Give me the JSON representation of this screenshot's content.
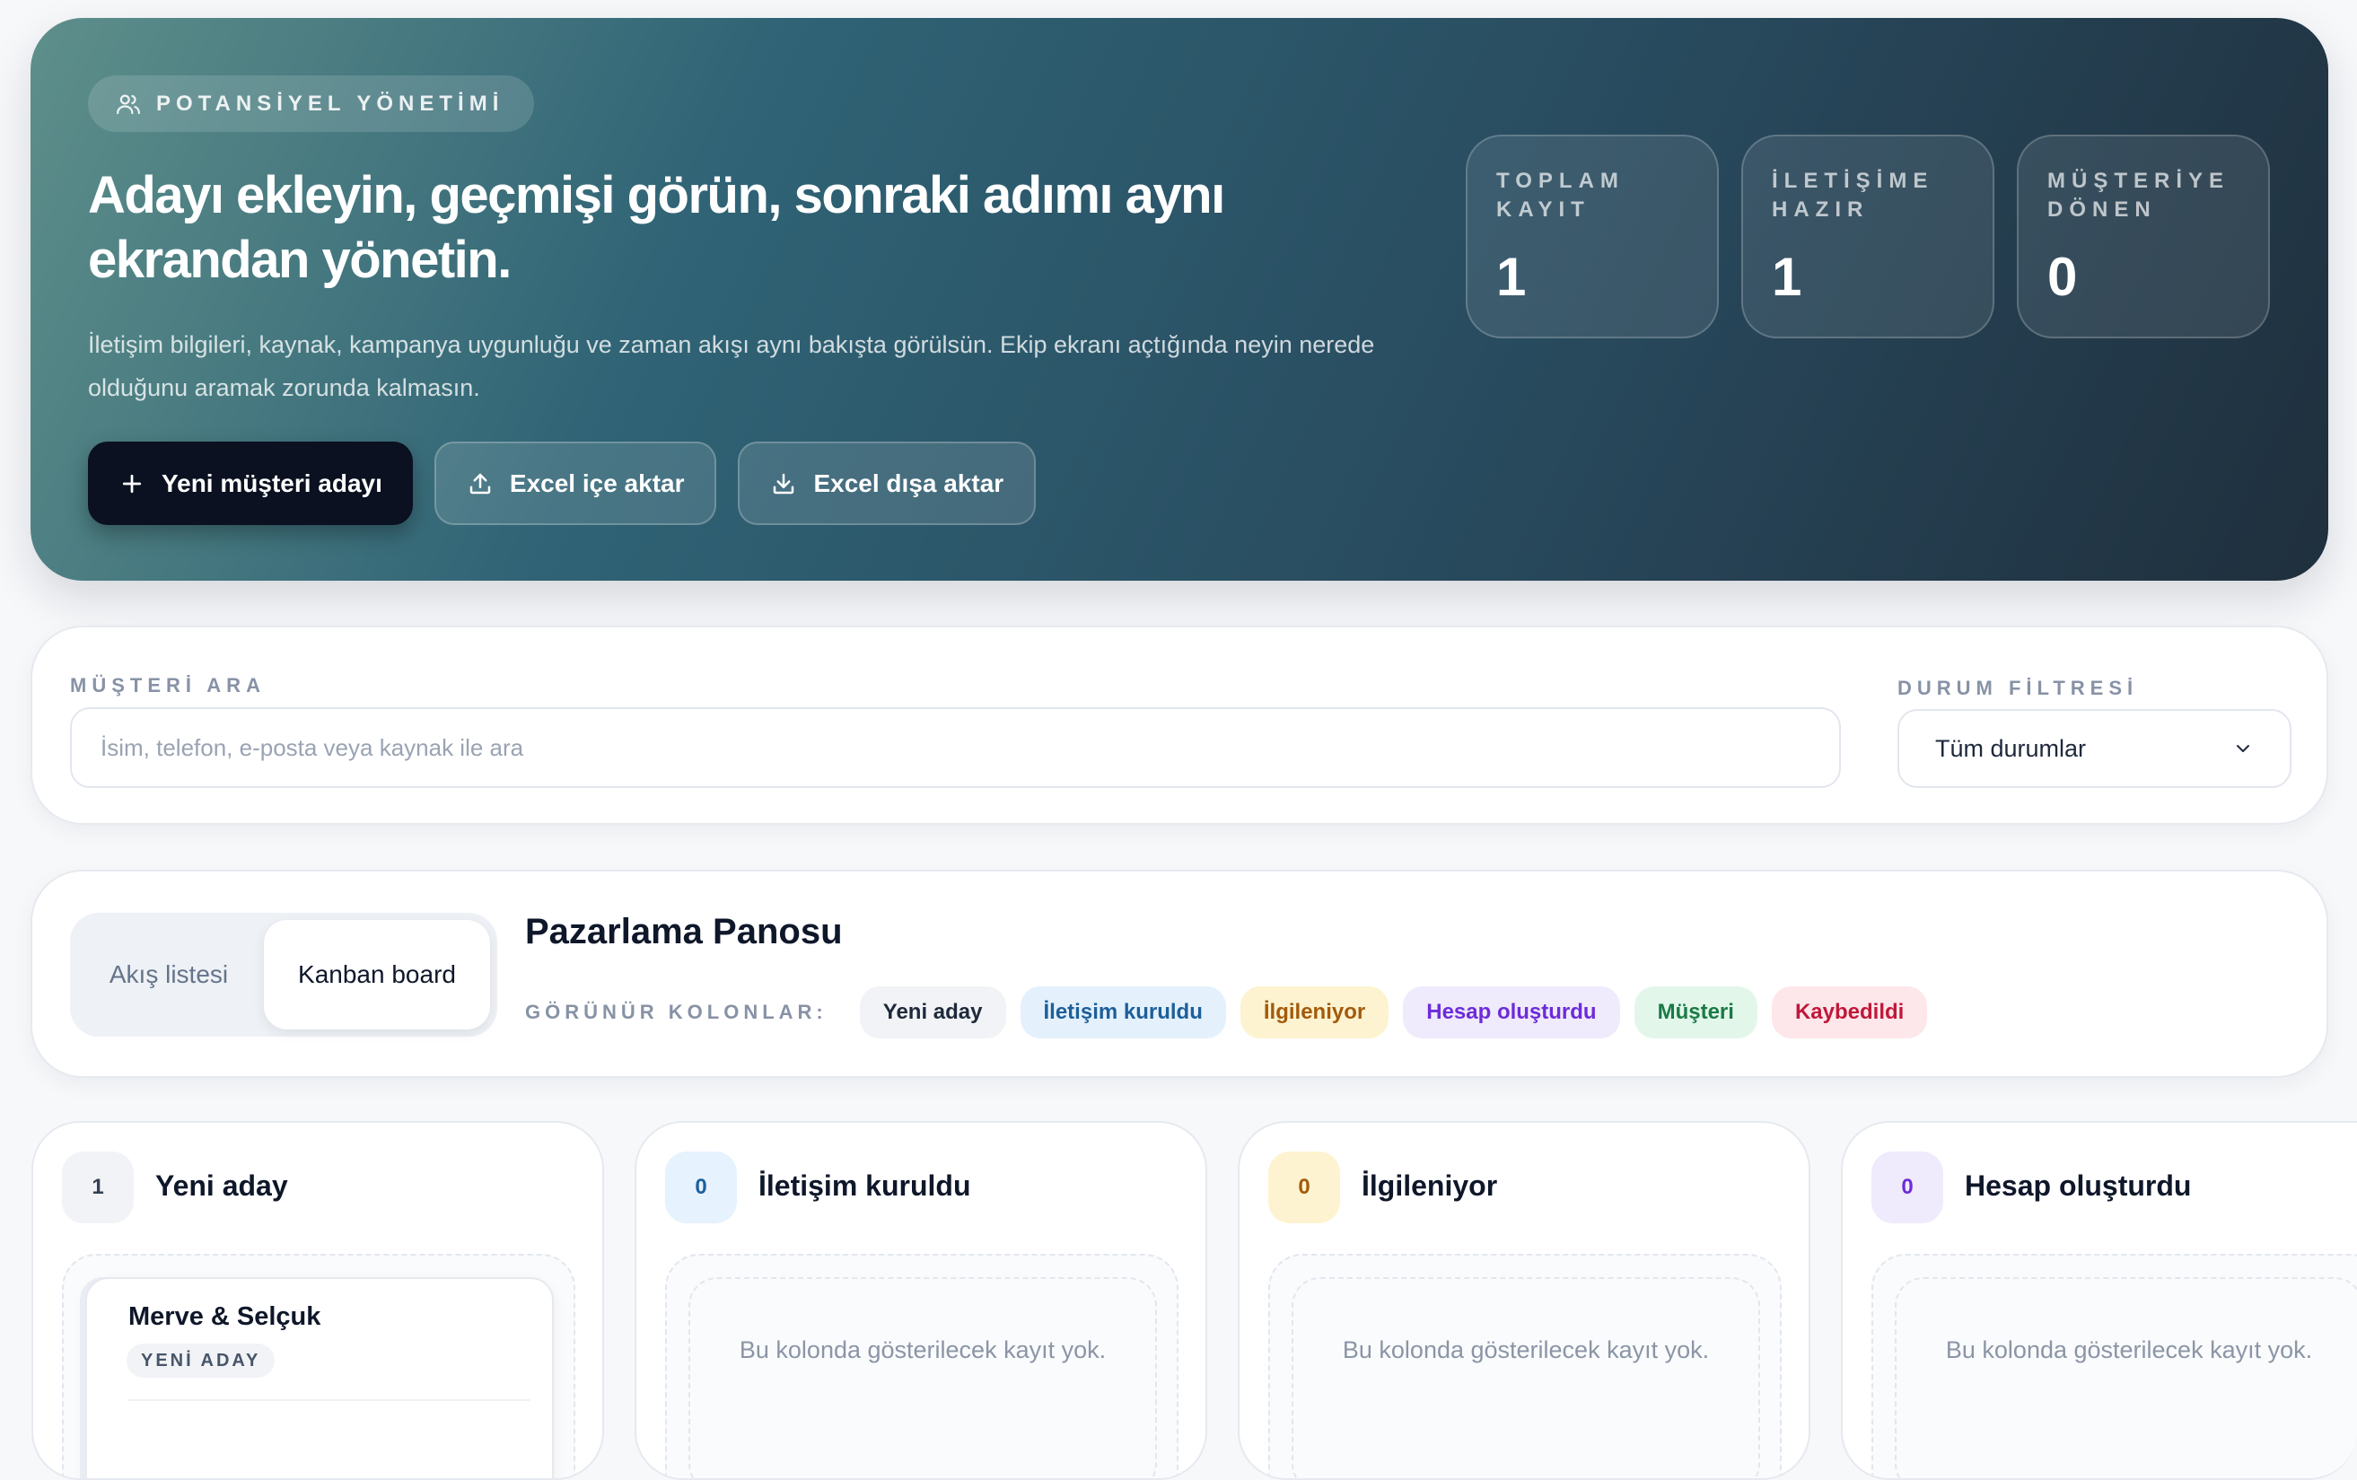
{
  "hero": {
    "badge": "POTANSİYEL YÖNETİMİ",
    "title": "Adayı ekleyin, geçmişi görün, sonraki adımı aynı ekrandan yönetin.",
    "description": "İletişim bilgileri, kaynak, kampanya uygunluğu ve zaman akışı aynı bakışta görülsün. Ekip ekranı açtığında neyin nerede olduğunu aramak zorunda kalmasın.",
    "actions": {
      "new_lead": "Yeni müşteri adayı",
      "import_excel": "Excel içe aktar",
      "export_excel": "Excel dışa aktar"
    },
    "stats": [
      {
        "label": "TOPLAM KAYIT",
        "value": "1"
      },
      {
        "label": "İLETİŞİME HAZIR",
        "value": "1"
      },
      {
        "label": "MÜŞTERİYE DÖNEN",
        "value": "0"
      }
    ]
  },
  "search": {
    "label": "MÜŞTERİ ARA",
    "placeholder": "İsim, telefon, e-posta veya kaynak ile ara",
    "status_label": "DURUM FİLTRESİ",
    "status_value": "Tüm durumlar"
  },
  "board": {
    "view_toggle": {
      "list": "Akış listesi",
      "kanban": "Kanban board"
    },
    "title": "Pazarlama Panosu",
    "columns_label": "GÖRÜNÜR KOLONLAR:",
    "chips": [
      {
        "label": "Yeni aday",
        "bg": "#f1f3f6",
        "fg": "#1e293b"
      },
      {
        "label": "İletişim kuruldu",
        "bg": "#e4f1fc",
        "fg": "#1d5f9a"
      },
      {
        "label": "İlgileniyor",
        "bg": "#fdf3d0",
        "fg": "#a35a0b"
      },
      {
        "label": "Hesap oluşturdu",
        "bg": "#efeafc",
        "fg": "#6d2bd9"
      },
      {
        "label": "Müşteri",
        "bg": "#e2f7ea",
        "fg": "#1a7a45"
      },
      {
        "label": "Kaybedildi",
        "bg": "#fde7ea",
        "fg": "#c0183a"
      }
    ]
  },
  "kanban": {
    "empty_text": "Bu kolonda gösterilecek kayıt yok.",
    "columns": [
      {
        "title": "Yeni aday",
        "count": "1",
        "count_bg": "#f1f3f6",
        "count_fg": "#334155",
        "cards": [
          {
            "name": "Merve & Selçuk",
            "status": "YENİ ADAY"
          }
        ]
      },
      {
        "title": "İletişim kuruldu",
        "count": "0",
        "count_bg": "#e6f2fd",
        "count_fg": "#1d5f9a",
        "cards": []
      },
      {
        "title": "İlgileniyor",
        "count": "0",
        "count_bg": "#fdf3d0",
        "count_fg": "#a35a0b",
        "cards": []
      },
      {
        "title": "Hesap oluşturdu",
        "count": "0",
        "count_bg": "#efeafc",
        "count_fg": "#6d2bd9",
        "cards": []
      }
    ]
  }
}
